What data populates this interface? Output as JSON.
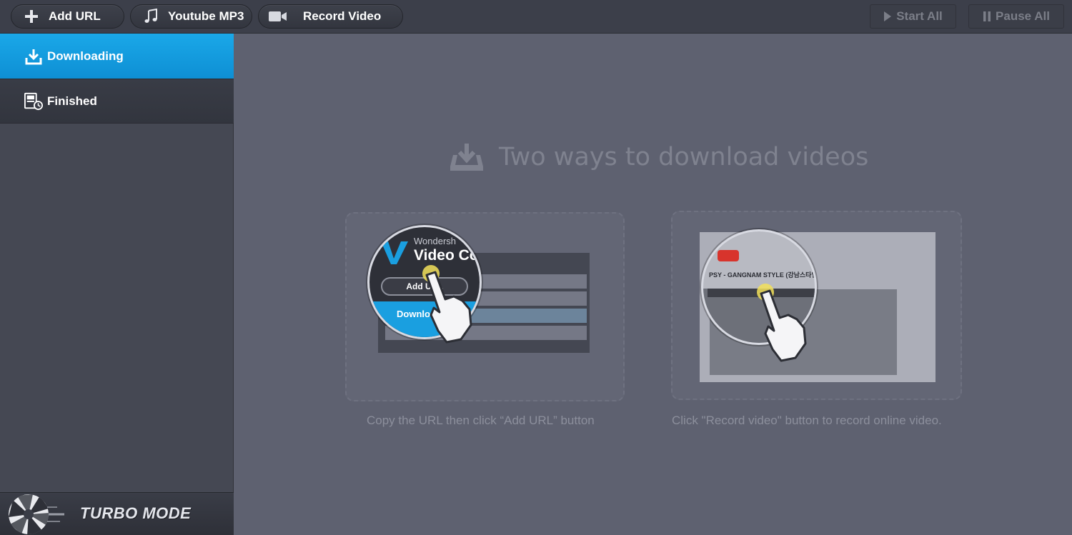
{
  "toolbar": {
    "add_url_label": "Add URL",
    "youtube_mp3_label": "Youtube MP3",
    "record_video_label": "Record Video",
    "start_all_label": "Start All",
    "pause_all_label": "Pause All"
  },
  "sidebar": {
    "items": [
      {
        "label": "Downloading",
        "icon": "download-icon",
        "active": true
      },
      {
        "label": "Finished",
        "icon": "finished-icon",
        "active": false
      }
    ],
    "turbo_label": "TURBO MODE"
  },
  "main": {
    "headline": "Two ways to download videos",
    "cards": [
      {
        "caption": "Copy the URL then click “Add URL” button",
        "illustration": {
          "app_title": "Wondersh",
          "app_name": "Video Co",
          "button": "Add URL",
          "tab": "Downloading"
        }
      },
      {
        "caption": "Click \"Record video\" button to record online video.",
        "illustration": {
          "video_title": "PSY - GANGNAM STYLE (강남스타일) M/V"
        }
      }
    ]
  },
  "colors": {
    "accent": "#1aa8e8",
    "toolbar_bg": "#3c3f4a",
    "sidebar_bg": "#454853",
    "main_bg": "#5e6170",
    "headline_text": "#7f828f"
  }
}
